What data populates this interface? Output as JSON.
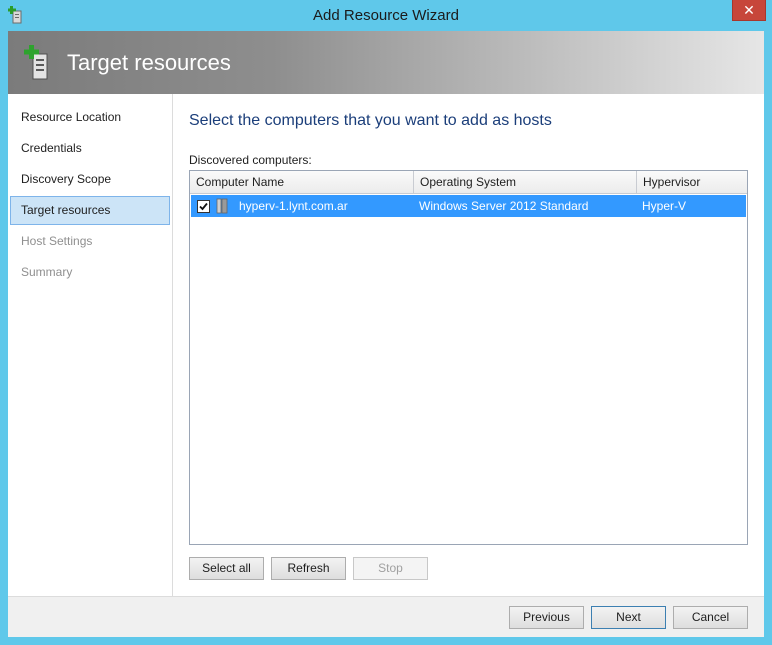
{
  "window": {
    "title": "Add Resource Wizard",
    "close_glyph": "✕"
  },
  "banner": {
    "title": "Target resources",
    "icon": "add-server-icon"
  },
  "sidebar": {
    "steps": [
      {
        "label": "Resource Location",
        "state": "done"
      },
      {
        "label": "Credentials",
        "state": "done"
      },
      {
        "label": "Discovery Scope",
        "state": "done"
      },
      {
        "label": "Target resources",
        "state": "active"
      },
      {
        "label": "Host Settings",
        "state": "disabled"
      },
      {
        "label": "Summary",
        "state": "disabled"
      }
    ]
  },
  "main": {
    "heading": "Select the computers that you want to add as hosts",
    "list_label": "Discovered computers:",
    "columns": [
      "Computer Name",
      "Operating System",
      "Hypervisor"
    ],
    "rows": [
      {
        "checked": true,
        "computer_name": "hyperv-1.lynt.com.ar",
        "operating_system": "Windows Server 2012 Standard",
        "hypervisor": "Hyper-V"
      }
    ],
    "buttons": {
      "select_all": "Select all",
      "refresh": "Refresh",
      "stop": "Stop"
    }
  },
  "footer": {
    "previous": "Previous",
    "next": "Next",
    "cancel": "Cancel"
  },
  "colors": {
    "title_bar": "#5fc8ea",
    "selection": "#3399ff",
    "heading": "#1b3e7a",
    "close": "#c7463a"
  }
}
